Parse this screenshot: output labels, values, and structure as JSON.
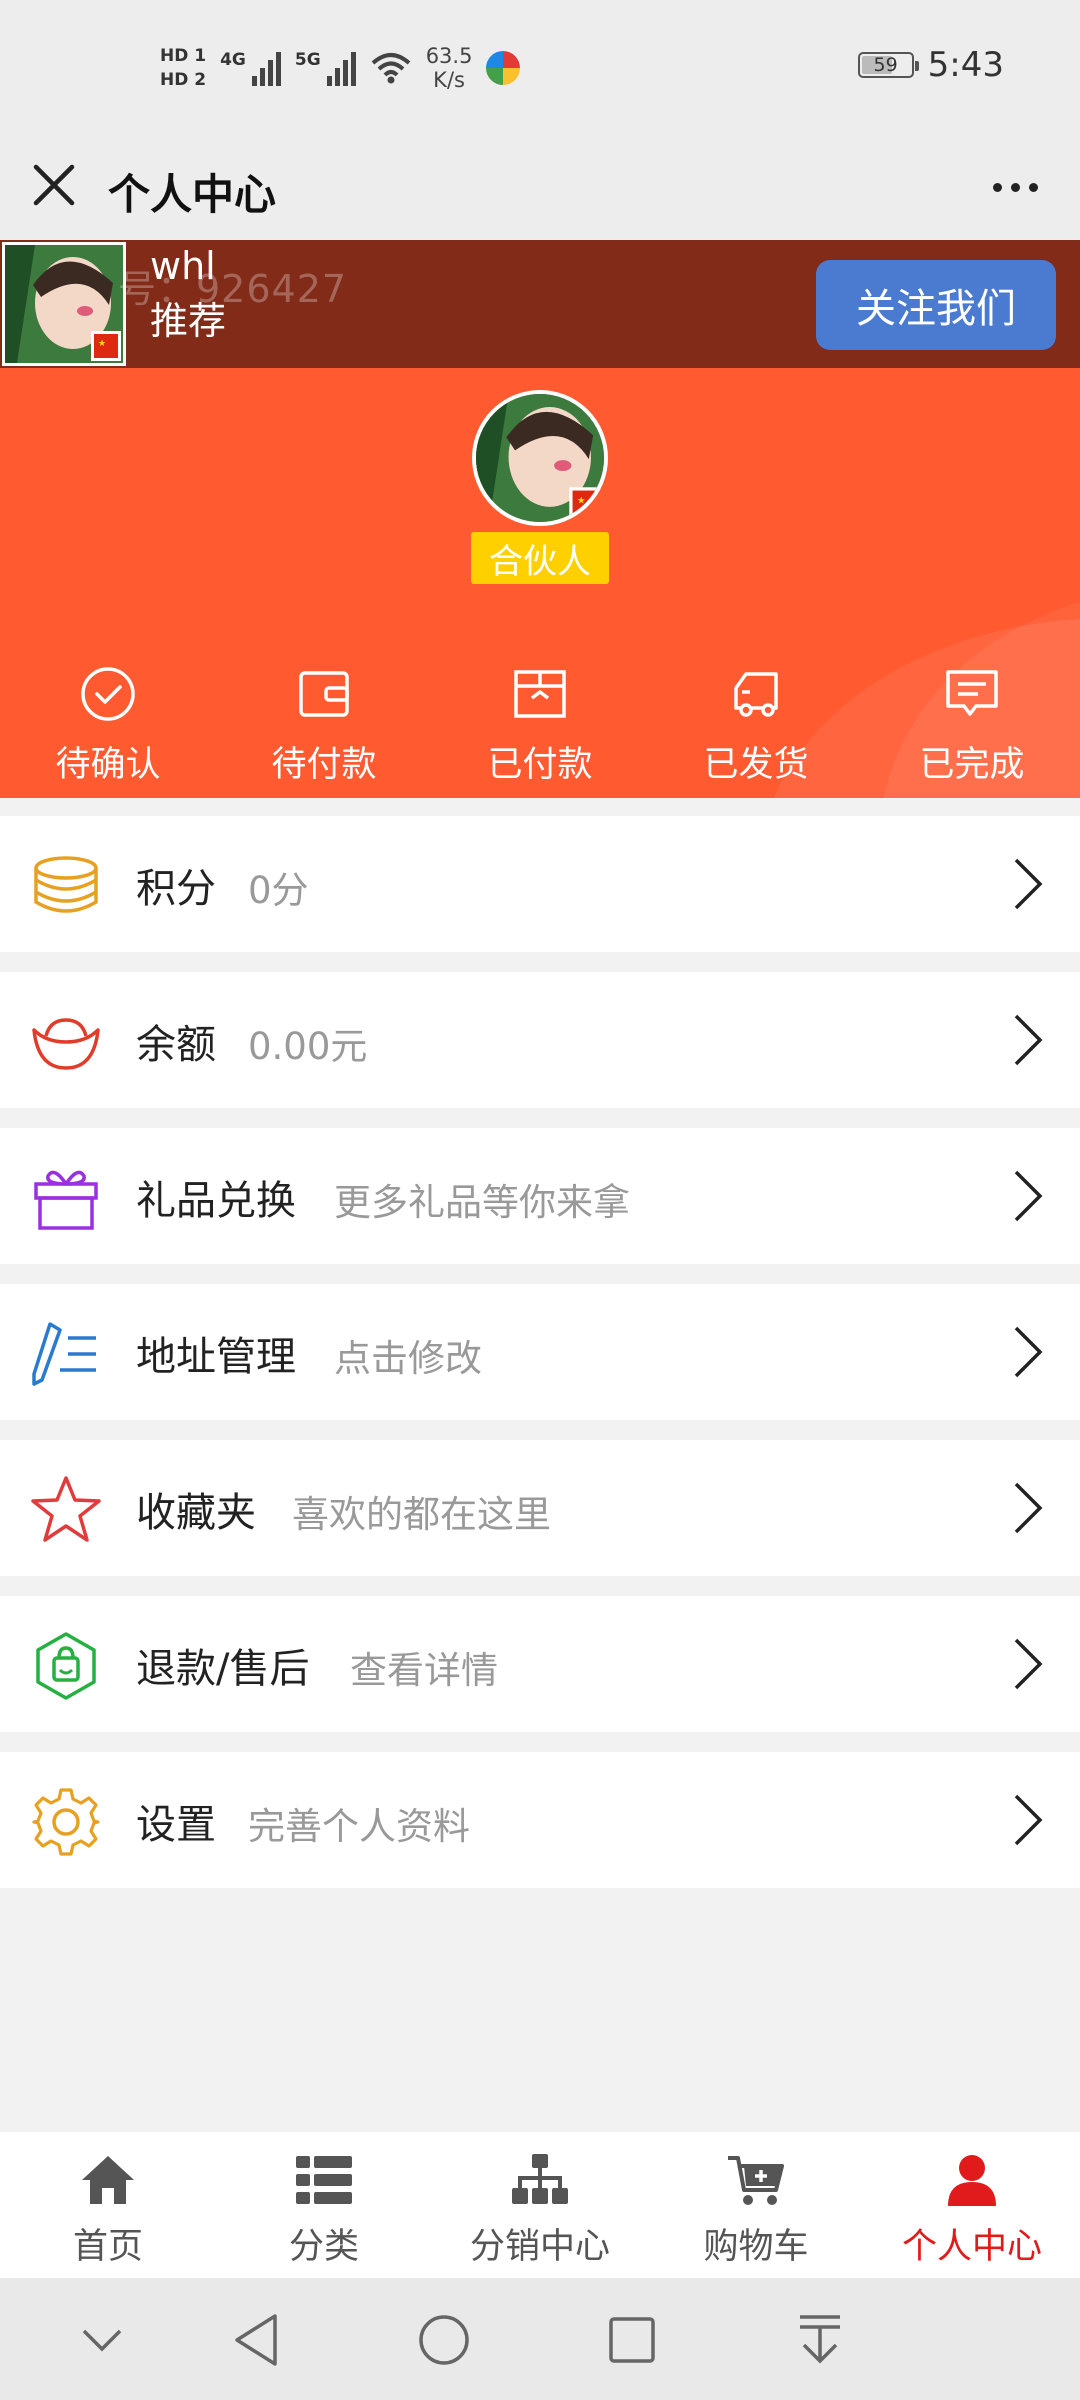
{
  "status_bar": {
    "hd1": "HD 1",
    "hd2": "HD 2",
    "net1": "4G",
    "net2": "5G",
    "speed_value": "63.5",
    "speed_unit": "K/s",
    "battery": "59",
    "time": "5:43"
  },
  "titlebar": {
    "title": "个人中心",
    "close_icon": "close-icon",
    "more_icon": "more-icon"
  },
  "banner": {
    "ghost_text": "号：926427",
    "name": "whl",
    "recommend": "推荐",
    "follow_label": "关注我们",
    "follow_color": "#4a7bd0",
    "background": "#812b18"
  },
  "profile": {
    "level": "合伙人",
    "level_color": "#ffd000",
    "background": "#ff5a30"
  },
  "orders": [
    {
      "label": "待确认",
      "icon": "check-circle-icon"
    },
    {
      "label": "待付款",
      "icon": "wallet-icon"
    },
    {
      "label": "已付款",
      "icon": "box-icon"
    },
    {
      "label": "已发货",
      "icon": "truck-icon"
    },
    {
      "label": "已完成",
      "icon": "comment-icon"
    }
  ],
  "menu": [
    {
      "title": "积分",
      "subtitle": "0分",
      "icon": "coins-icon",
      "color": "#e8a020"
    },
    {
      "title": "余额",
      "subtitle": "0.00元",
      "icon": "gold-ingot-icon",
      "color": "#e23b2a"
    },
    {
      "title": "礼品兑换",
      "subtitle": "更多礼品等你来拿",
      "icon": "gift-icon",
      "color": "#9b30e0"
    },
    {
      "title": "地址管理",
      "subtitle": "点击修改",
      "icon": "pen-list-icon",
      "color": "#2a7bd0"
    },
    {
      "title": "收藏夹",
      "subtitle": "喜欢的都在这里",
      "icon": "star-icon",
      "color": "#e23b3b"
    },
    {
      "title": "退款/售后",
      "subtitle": "查看详情",
      "icon": "shopping-bag-icon",
      "color": "#25b040"
    },
    {
      "title": "设置",
      "subtitle": "完善个人资料",
      "icon": "gear-icon",
      "color": "#e8a020"
    }
  ],
  "tabs": [
    {
      "label": "首页",
      "icon": "home-icon"
    },
    {
      "label": "分类",
      "icon": "list-icon"
    },
    {
      "label": "分销中心",
      "icon": "network-icon"
    },
    {
      "label": "购物车",
      "icon": "cart-icon"
    },
    {
      "label": "个人中心",
      "icon": "user-icon",
      "active": true
    }
  ],
  "active_tab_color": "#e11b1b"
}
